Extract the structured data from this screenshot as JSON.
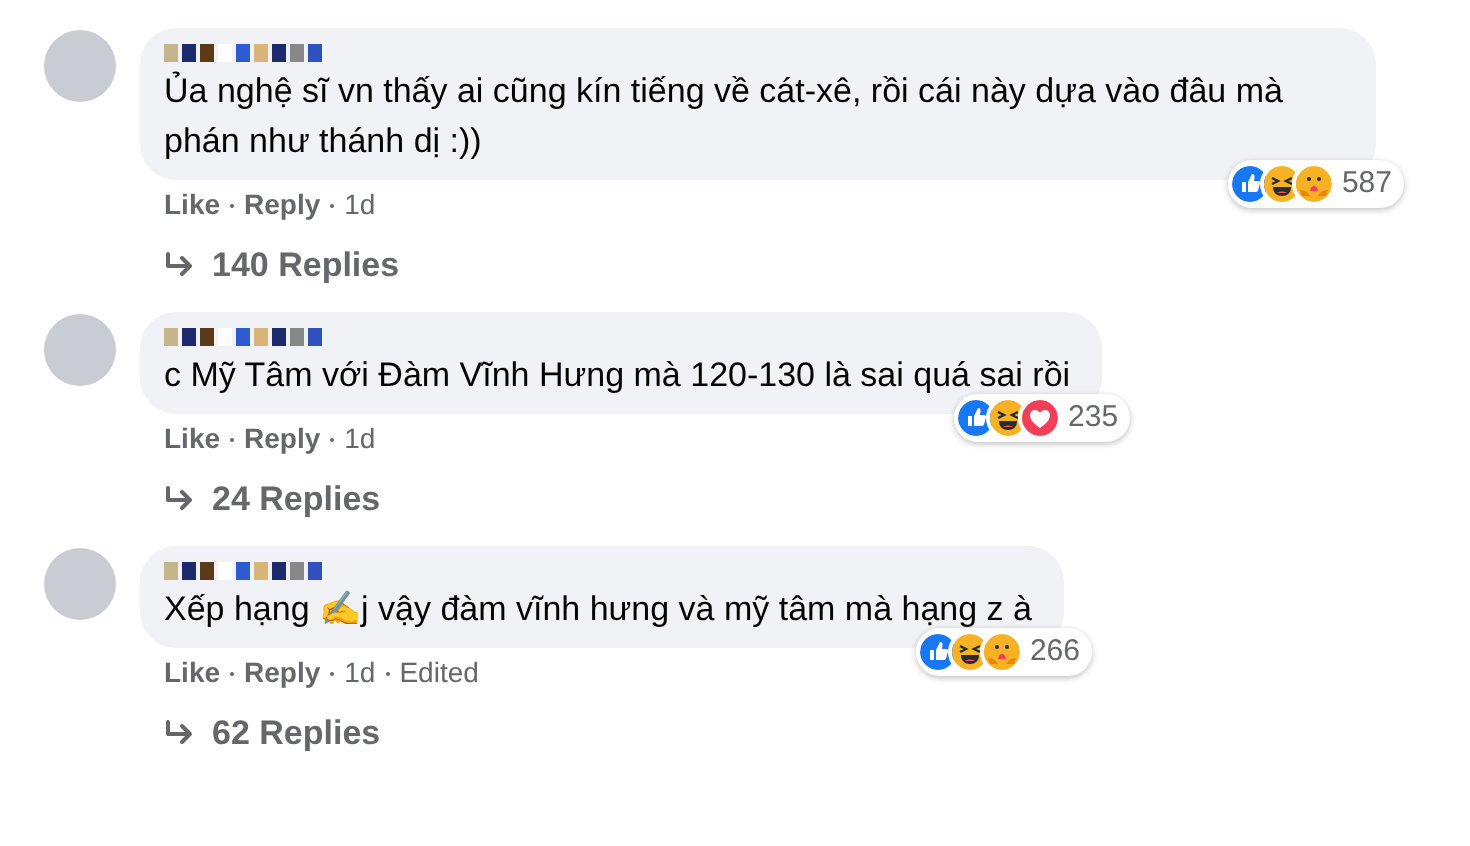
{
  "comments": [
    {
      "text": "Ủa nghệ sĩ vn thấy ai cũng kín tiếng về cát-xê, rồi cái này dựa vào đâu mà phán như thánh dị :))",
      "reactions": [
        {
          "kind": "like"
        },
        {
          "kind": "haha"
        },
        {
          "kind": "care"
        }
      ],
      "reaction_count": "587",
      "meta": [
        {
          "kind": "link",
          "text": "Like"
        },
        {
          "kind": "link",
          "text": "Reply"
        },
        {
          "kind": "time",
          "text": "1d"
        }
      ],
      "replies": "140 Replies"
    },
    {
      "text": "c Mỹ Tâm với Đàm Vĩnh Hưng mà 120-130 là sai quá sai rồi",
      "reactions": [
        {
          "kind": "like"
        },
        {
          "kind": "haha"
        },
        {
          "kind": "love"
        }
      ],
      "reaction_count": "235",
      "meta": [
        {
          "kind": "link",
          "text": "Like"
        },
        {
          "kind": "link",
          "text": "Reply"
        },
        {
          "kind": "time",
          "text": "1d"
        }
      ],
      "replies": "24 Replies"
    },
    {
      "text": "Xếp hạng ✍j vậy đàm vĩnh hưng và mỹ tâm mà hạng z à",
      "reactions": [
        {
          "kind": "like"
        },
        {
          "kind": "haha"
        },
        {
          "kind": "care"
        }
      ],
      "reaction_count": "266",
      "meta": [
        {
          "kind": "link",
          "text": "Like"
        },
        {
          "kind": "link",
          "text": "Reply"
        },
        {
          "kind": "time",
          "text": "1d"
        },
        {
          "kind": "note",
          "text": "Edited"
        }
      ],
      "replies": "62 Replies"
    }
  ]
}
